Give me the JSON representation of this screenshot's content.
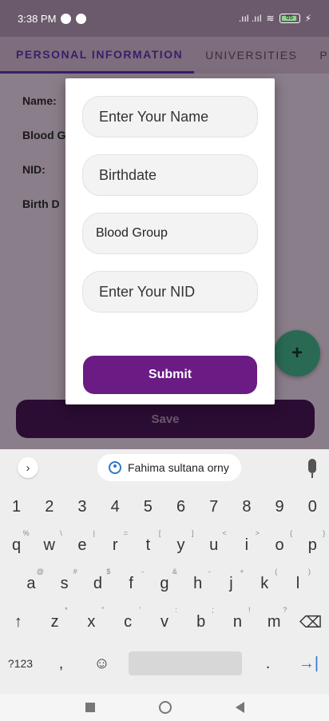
{
  "status": {
    "time": "3:38 PM",
    "signal": ".ııl .ııl",
    "wifi": "≋",
    "battery": "65",
    "charging": "⚡"
  },
  "tabs": [
    {
      "label": "PERSONAL INFORMATION"
    },
    {
      "label": "UNIVERSITIES"
    },
    {
      "label": "PHO"
    }
  ],
  "profile": {
    "name_label": "Name:",
    "blood_label": "Blood G",
    "nid_label": "NID:",
    "birth_label": "Birth D"
  },
  "fab": {
    "symbol": "+"
  },
  "save": {
    "label": "Save"
  },
  "dialog": {
    "name_placeholder": "Enter Your Name",
    "birthdate_placeholder": "Birthdate",
    "blood_placeholder": "Blood Group",
    "nid_placeholder": "Enter Your NID",
    "submit_label": "Submit"
  },
  "keyboard": {
    "suggestion": "Fahima sultana orny",
    "numbers": [
      "1",
      "2",
      "3",
      "4",
      "5",
      "6",
      "7",
      "8",
      "9",
      "0"
    ],
    "row1": [
      {
        "k": "q",
        "s": "%"
      },
      {
        "k": "w",
        "s": "\\"
      },
      {
        "k": "e",
        "s": "|"
      },
      {
        "k": "r",
        "s": "="
      },
      {
        "k": "t",
        "s": "["
      },
      {
        "k": "y",
        "s": "]"
      },
      {
        "k": "u",
        "s": "<"
      },
      {
        "k": "i",
        "s": ">"
      },
      {
        "k": "o",
        "s": "{"
      },
      {
        "k": "p",
        "s": "}"
      }
    ],
    "row2": [
      {
        "k": "a",
        "s": "@"
      },
      {
        "k": "s",
        "s": "#"
      },
      {
        "k": "d",
        "s": "$"
      },
      {
        "k": "f",
        "s": "-"
      },
      {
        "k": "g",
        "s": "&"
      },
      {
        "k": "h",
        "s": "-"
      },
      {
        "k": "j",
        "s": "+"
      },
      {
        "k": "k",
        "s": "("
      },
      {
        "k": "l",
        "s": ")"
      }
    ],
    "row3": [
      {
        "k": "z",
        "s": "*"
      },
      {
        "k": "x",
        "s": "\""
      },
      {
        "k": "c",
        "s": "'"
      },
      {
        "k": "v",
        "s": ":"
      },
      {
        "k": "b",
        "s": ";"
      },
      {
        "k": "n",
        "s": "!"
      },
      {
        "k": "m",
        "s": "?"
      }
    ],
    "shift": "↑",
    "backspace": "⌫",
    "symbols": "?123",
    "comma": ",",
    "emoji": "☺",
    "period": ".",
    "enter": "→|"
  }
}
